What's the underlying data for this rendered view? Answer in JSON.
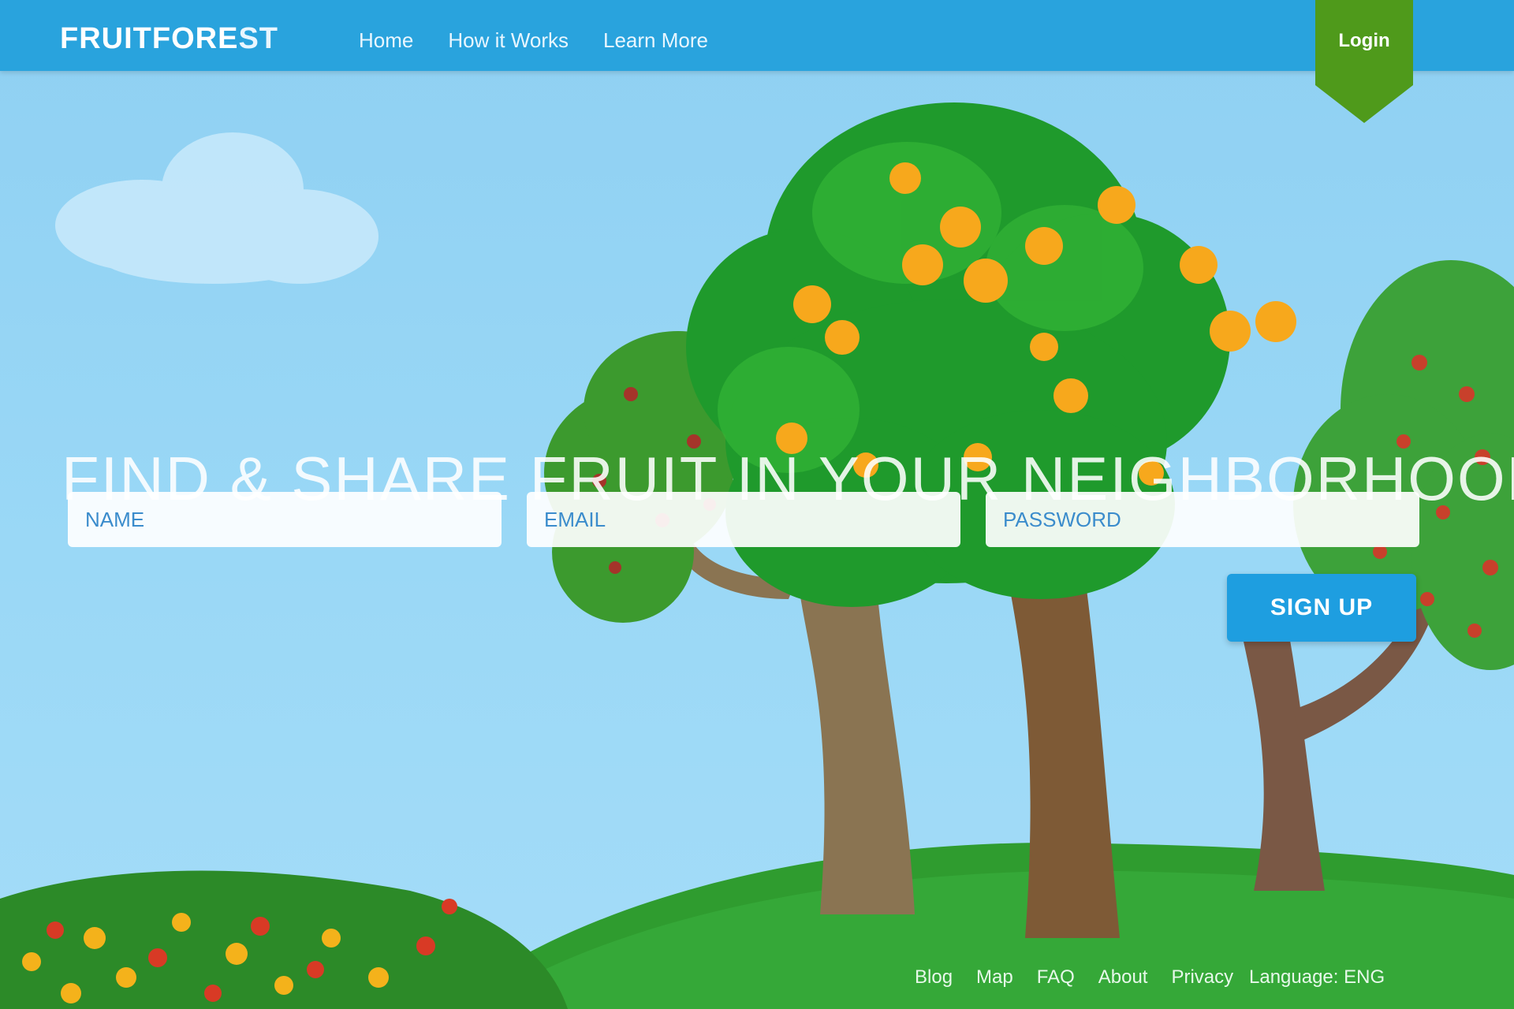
{
  "header": {
    "brand_main": "FRUITFORE",
    "brand_suffix": "ST",
    "nav": [
      "Home",
      "How it Works",
      "Learn More"
    ],
    "login_label": "Login"
  },
  "hero": {
    "headline": "FIND & SHARE FRUIT IN YOUR NEIGHBORHOOD",
    "name_placeholder": "NAME",
    "email_placeholder": "EMAIL",
    "password_placeholder": "PASSWORD",
    "signup_label": "SIGN UP"
  },
  "footer": {
    "links": [
      "Blog",
      "Map",
      "FAQ",
      "About",
      "Privacy"
    ],
    "language": "Language: ENG"
  },
  "colors": {
    "header": "#29a3dd",
    "sky": "#9ad8f6",
    "grass": "#2f9c2f",
    "login_ribbon": "#4f9a1b",
    "signup": "#1e9ee0"
  },
  "icons": [
    "cloud-icon",
    "login-ribbon-icon"
  ]
}
